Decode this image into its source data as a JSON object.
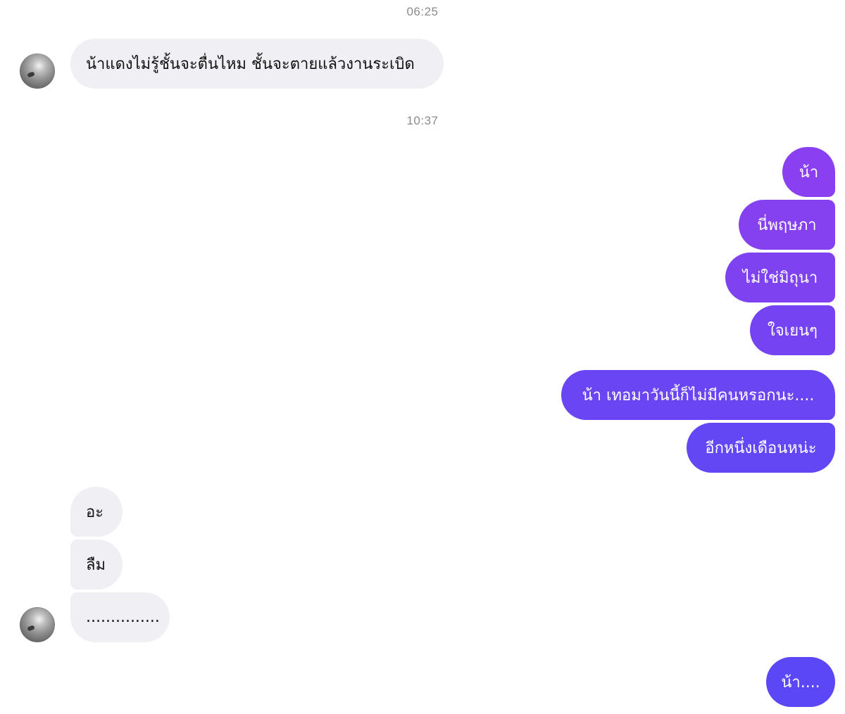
{
  "conversation": {
    "timestamps": [
      "06:25",
      "10:37"
    ],
    "messages": [
      {
        "text": "น้าแดงไม่รู้ชั้นจะตื่นไหม ชั้นจะตายแล้วงานระเบิด"
      },
      {
        "text": "น้า"
      },
      {
        "text": "นี่พฤษภา"
      },
      {
        "text": "ไม่ใช่มิถุนา"
      },
      {
        "text": "ใจเยนๆ"
      },
      {
        "text": "น้า เทอมาวันนี้ก็ไม่มีคนหรอกนะ...."
      },
      {
        "text": "อีกหนึ่งเดือนหน่ะ"
      },
      {
        "text": "อะ"
      },
      {
        "text": "ลืม"
      },
      {
        "text": "..............."
      },
      {
        "text": "น้า...."
      }
    ]
  },
  "colors": {
    "incoming_bubble": "#f0f0f4",
    "outgoing_gradient_top": "#8a3ff0",
    "outgoing_gradient_bottom": "#5b47f5",
    "timestamp_text": "#8a8a8f"
  },
  "icons": {
    "avatar": "profile-photo-avatar"
  }
}
